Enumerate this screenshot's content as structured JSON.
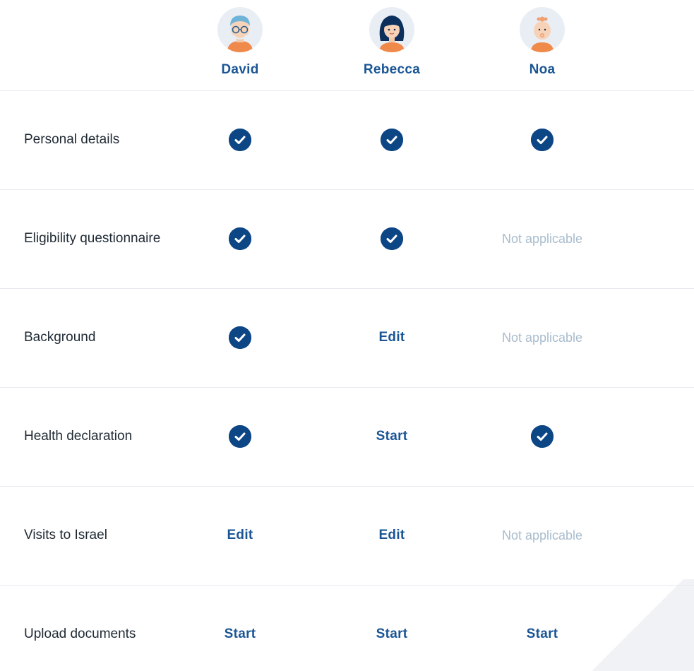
{
  "people": [
    {
      "name": "David",
      "avatar_icon": "man-glasses-avatar-icon",
      "hair_color": "#6fb4d8"
    },
    {
      "name": "Rebecca",
      "avatar_icon": "woman-avatar-icon",
      "hair_color": "#0d2f5c"
    },
    {
      "name": "Noa",
      "avatar_icon": "baby-avatar-icon",
      "hair_color": "#f0a070"
    }
  ],
  "rows": [
    {
      "label": "Personal details",
      "cells": [
        {
          "type": "check",
          "icon": "check-circle-icon"
        },
        {
          "type": "check",
          "icon": "check-circle-icon"
        },
        {
          "type": "check",
          "icon": "check-circle-icon"
        }
      ]
    },
    {
      "label": "Eligibility questionnaire",
      "cells": [
        {
          "type": "check",
          "icon": "check-circle-icon"
        },
        {
          "type": "check",
          "icon": "check-circle-icon"
        },
        {
          "type": "na",
          "text": "Not applicable"
        }
      ]
    },
    {
      "label": "Background",
      "cells": [
        {
          "type": "check",
          "icon": "check-circle-icon"
        },
        {
          "type": "link",
          "text": "Edit"
        },
        {
          "type": "na",
          "text": "Not applicable"
        }
      ]
    },
    {
      "label": "Health declaration",
      "cells": [
        {
          "type": "check",
          "icon": "check-circle-icon"
        },
        {
          "type": "link",
          "text": "Start"
        },
        {
          "type": "check",
          "icon": "check-circle-icon"
        }
      ]
    },
    {
      "label": "Visits to Israel",
      "cells": [
        {
          "type": "link",
          "text": "Edit"
        },
        {
          "type": "link",
          "text": "Edit"
        },
        {
          "type": "na",
          "text": "Not applicable"
        }
      ]
    },
    {
      "label": "Upload documents",
      "cells": [
        {
          "type": "link",
          "text": "Start"
        },
        {
          "type": "link",
          "text": "Start"
        },
        {
          "type": "link",
          "text": "Start"
        }
      ]
    }
  ],
  "colors": {
    "accent": "#1a5594",
    "check_fill": "#0d4685",
    "muted": "#a8bccd",
    "divider": "#e7e9ee"
  }
}
